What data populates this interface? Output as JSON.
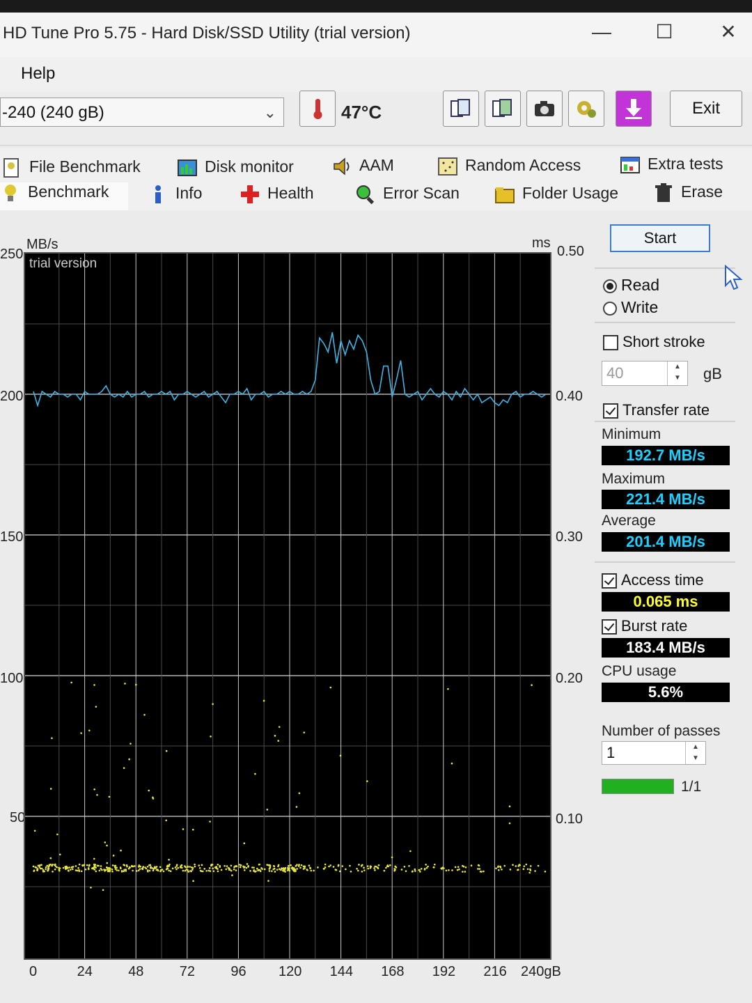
{
  "window": {
    "title": "HD Tune Pro 5.75 - Hard Disk/SSD Utility (trial version)",
    "minimize": "—",
    "maximize": "☐",
    "close": "✕"
  },
  "menu": {
    "help": "Help"
  },
  "toolbar": {
    "drive": "-240 (240 gB)",
    "temperature": "47°C",
    "exit_label": "Exit",
    "icons": [
      "copy-info-icon",
      "copy-screenshot-icon",
      "camera-icon",
      "options-icon",
      "save-download-icon"
    ]
  },
  "tabs": {
    "row1": [
      "File Benchmark",
      "Disk monitor",
      "AAM",
      "Random Access",
      "Extra tests"
    ],
    "row2": [
      "Benchmark",
      "Info",
      "Health",
      "Error Scan",
      "Folder Usage",
      "Erase"
    ],
    "active": "Benchmark"
  },
  "graph": {
    "left_unit": "MB/s",
    "right_unit": "ms",
    "watermark": "trial version",
    "left_ticks": [
      "250",
      "200",
      "150",
      "100",
      "50"
    ],
    "right_ticks": [
      "0.50",
      "0.40",
      "0.30",
      "0.20",
      "0.10"
    ],
    "x_ticks": [
      "0",
      "24",
      "48",
      "72",
      "96",
      "120",
      "144",
      "168",
      "192",
      "216",
      "240gB"
    ]
  },
  "panel": {
    "start_label": "Start",
    "read_label": "Read",
    "write_label": "Write",
    "short_stroke_label": "Short stroke",
    "short_stroke_value": "40",
    "short_stroke_unit": "gB",
    "transfer_rate_label": "Transfer rate",
    "minimum_label": "Minimum",
    "minimum_value": "192.7 MB/s",
    "maximum_label": "Maximum",
    "maximum_value": "221.4 MB/s",
    "average_label": "Average",
    "average_value": "201.4 MB/s",
    "access_time_label": "Access time",
    "access_time_value": "0.065 ms",
    "burst_rate_label": "Burst rate",
    "burst_rate_value": "183.4 MB/s",
    "cpu_usage_label": "CPU usage",
    "cpu_usage_value": "5.6%",
    "passes_label": "Number of passes",
    "passes_value": "1",
    "progress_text": "1/1",
    "progress_fraction": 1.0
  },
  "colors": {
    "transfer_line": "#3fb4e6",
    "access_points": "#e8e83a",
    "value_text": "#1ed0ff"
  },
  "chart_data": {
    "type": "line",
    "xlabel": "",
    "ylabel": "MB/s",
    "y2label": "ms",
    "xlim": [
      0,
      240
    ],
    "ylim": [
      0,
      250
    ],
    "y2lim": [
      0,
      0.5
    ],
    "x_ticks": [
      0,
      24,
      48,
      72,
      96,
      120,
      144,
      168,
      192,
      216,
      240
    ],
    "series": [
      {
        "kind": "transfer",
        "x": [
          0,
          2,
          4,
          6,
          8,
          10,
          12,
          14,
          16,
          18,
          20,
          22,
          24,
          26,
          28,
          30,
          32,
          34,
          36,
          38,
          40,
          42,
          44,
          46,
          48,
          50,
          52,
          54,
          56,
          58,
          60,
          62,
          64,
          66,
          68,
          70,
          72,
          74,
          76,
          78,
          80,
          82,
          84,
          86,
          88,
          90,
          92,
          94,
          96,
          98,
          100,
          102,
          104,
          106,
          108,
          110,
          112,
          114,
          116,
          118,
          120,
          122,
          124,
          126,
          128,
          130,
          132,
          134,
          136,
          138,
          140,
          142,
          144,
          146,
          148,
          150,
          152,
          154,
          156,
          158,
          160,
          162,
          164,
          166,
          168,
          170,
          172,
          174,
          176,
          178,
          180,
          182,
          184,
          186,
          188,
          190,
          192,
          194,
          196,
          198,
          200,
          202,
          204,
          206,
          208,
          210,
          212,
          214,
          216,
          218,
          220,
          222,
          224,
          226,
          228,
          230,
          232,
          234,
          236,
          238,
          240
        ],
        "y": [
          201,
          196,
          201,
          200,
          199,
          201,
          200,
          200,
          199,
          200,
          200,
          198,
          201,
          200,
          200,
          200,
          201,
          203,
          200,
          199,
          200,
          199,
          201,
          199,
          200,
          200,
          201,
          199,
          200,
          200,
          201,
          200,
          201,
          198,
          200,
          200,
          201,
          200,
          199,
          200,
          201,
          199,
          200,
          201,
          199,
          197,
          200,
          200,
          201,
          200,
          202,
          198,
          200,
          200,
          201,
          199,
          200,
          200,
          201,
          200,
          201,
          200,
          200,
          201,
          200,
          201,
          205,
          220,
          218,
          215,
          222,
          211,
          219,
          214,
          219,
          216,
          221,
          219,
          215,
          205,
          200,
          201,
          210,
          210,
          199,
          205,
          212,
          200,
          199,
          200,
          201,
          198,
          200,
          202,
          200,
          199,
          201,
          200,
          198,
          201,
          199,
          202,
          200,
          198,
          200,
          197,
          198,
          199,
          197,
          196,
          198,
          197,
          200,
          201,
          199,
          200,
          200,
          201,
          200,
          199,
          200
        ]
      }
    ],
    "access_time_ms_band": [
      0.055,
      0.07
    ],
    "stats": {
      "minimum": "192.7 MB/s",
      "maximum": "221.4 MB/s",
      "average": "201.4 MB/s",
      "access_time": "0.065 ms",
      "burst_rate": "183.4 MB/s",
      "cpu_usage": "5.6%"
    }
  }
}
